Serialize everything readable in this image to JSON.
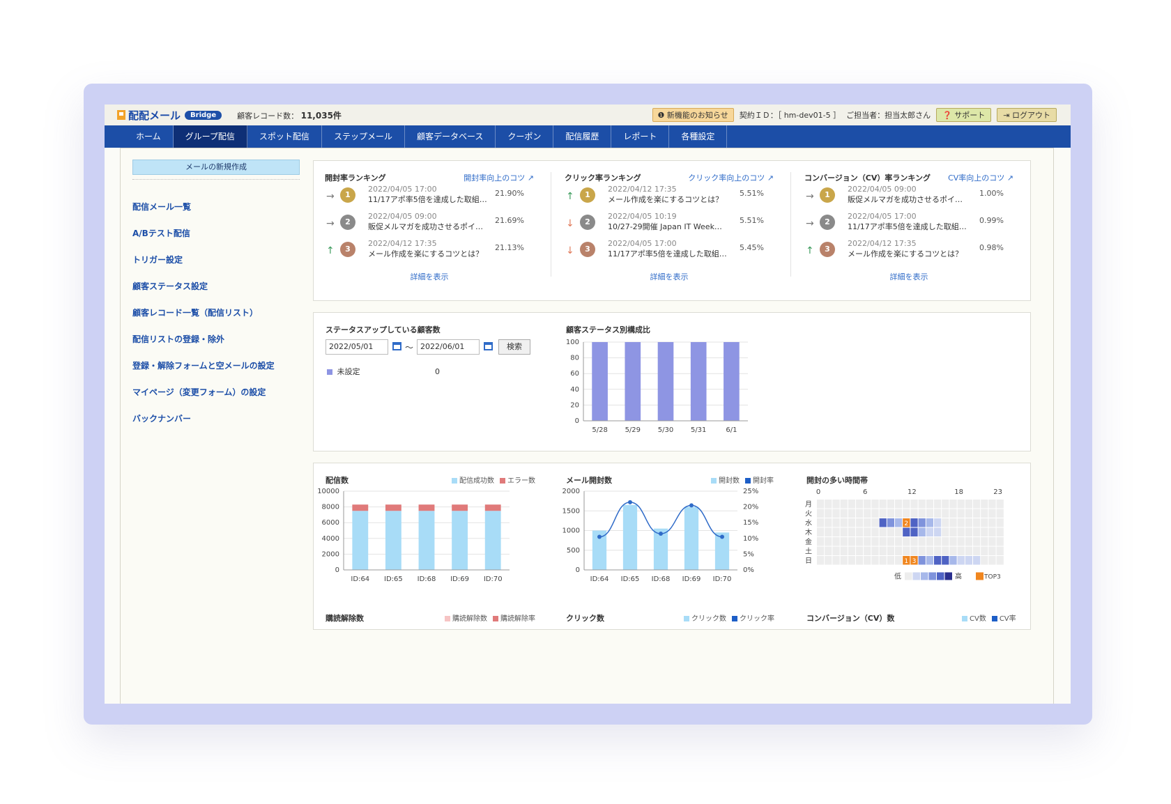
{
  "header": {
    "logo_text": "配配メール",
    "badge": "Bridge",
    "record_label": "顧客レコード数：",
    "record_value": "11,035件",
    "news_label": "新機能のお知らせ",
    "contract": "契約ＩＤ：［ hm-dev01-5 ］",
    "owner": "ご担当者：担当太郎さん",
    "support": "サポート",
    "logout": "ログアウト"
  },
  "nav": [
    "ホーム",
    "グループ配信",
    "スポット配信",
    "ステップメール",
    "顧客データベース",
    "クーポン",
    "配信履歴",
    "レポート",
    "各種設定"
  ],
  "sidebar": {
    "new_button": "メールの新規作成",
    "links": [
      "配信メール一覧",
      "A/Bテスト配信",
      "トリガー設定",
      "顧客ステータス設定",
      "顧客レコード一覧（配信リスト）",
      "配信リストの登録・除外",
      "登録・解除フォームと空メールの設定",
      "マイページ（変更フォーム）の設定",
      "バックナンバー"
    ]
  },
  "rankings": [
    {
      "title": "開封率ランキング",
      "tip": "開封率向上のコツ",
      "detail": "詳細を表示",
      "rows": [
        {
          "arrow": "→",
          "rank": "1",
          "date": "2022/04/05 17:00",
          "text": "11/17アポ率5倍を達成した取組…",
          "pct": "21.90%"
        },
        {
          "arrow": "→",
          "rank": "2",
          "date": "2022/04/05 09:00",
          "text": "販促メルマガを成功させるポイン…",
          "pct": "21.69%"
        },
        {
          "arrow": "↑",
          "rank": "3",
          "date": "2022/04/12 17:35",
          "text": "メール作成を楽にするコツとは？",
          "pct": "21.13%"
        }
      ]
    },
    {
      "title": "クリック率ランキング",
      "tip": "クリック率向上のコツ",
      "detail": "詳細を表示",
      "rows": [
        {
          "arrow": "↑",
          "rank": "1",
          "date": "2022/04/12 17:35",
          "text": "メール作成を楽にするコツとは？",
          "pct": "5.51%"
        },
        {
          "arrow": "↓",
          "rank": "2",
          "date": "2022/04/05 10:19",
          "text": "10/27-29開催 Japan IT Week…",
          "pct": "5.51%"
        },
        {
          "arrow": "↓",
          "rank": "3",
          "date": "2022/04/05 17:00",
          "text": "11/17アポ率5倍を達成した取組…",
          "pct": "5.45%"
        }
      ]
    },
    {
      "title": "コンバージョン（CV）率ランキング",
      "tip": "CV率向上のコツ",
      "detail": "詳細を表示",
      "rows": [
        {
          "arrow": "→",
          "rank": "1",
          "date": "2022/04/05 09:00",
          "text": "販促メルマガを成功させるポイン…",
          "pct": "1.00%"
        },
        {
          "arrow": "→",
          "rank": "2",
          "date": "2022/04/05 17:00",
          "text": "11/17アポ率5倍を達成した取組…",
          "pct": "0.99%"
        },
        {
          "arrow": "↑",
          "rank": "3",
          "date": "2022/04/12 17:35",
          "text": "メール作成を楽にするコツとは？",
          "pct": "0.98%"
        }
      ]
    }
  ],
  "status": {
    "title": "ステータスアップしている顧客数",
    "date_from": "2022/05/01",
    "tilde": "～",
    "date_to": "2022/06/01",
    "search": "検索",
    "legend_label": "未設定",
    "legend_value": "0",
    "composition_title": "顧客ステータス別構成比"
  },
  "bottom_titles": {
    "delivery": "配信数",
    "open": "メール開封数",
    "heatmap": "開封の多い時間帯",
    "unsub": "購読解除数",
    "click": "クリック数",
    "cv": "コンバージョン（CV）数"
  },
  "bottom_legends": {
    "delivery": [
      "配信成功数",
      "エラー数"
    ],
    "open": [
      "開封数",
      "開封率"
    ],
    "unsub": [
      "購読解除数",
      "購読解除率"
    ],
    "click": [
      "クリック数",
      "クリック率"
    ],
    "cv": [
      "CV数",
      "CV率"
    ]
  },
  "colors": {
    "gold": "#c9a64a",
    "silver": "#8a8a8a",
    "bronze": "#b9826a",
    "bar_status": "#8e95e3",
    "bar_light": "#a8dcf7",
    "bar_error": "#e07a7a",
    "line": "#2f6bc8",
    "up": "#3a9a5a",
    "down": "#e07a5a",
    "flat": "#777777",
    "top3": "#f0861f"
  },
  "chart_data": [
    {
      "type": "bar",
      "title": "顧客ステータス別構成比",
      "categories": [
        "5/28",
        "5/29",
        "5/30",
        "5/31",
        "6/1"
      ],
      "series": [
        {
          "values": [
            100,
            100,
            100,
            100,
            100
          ]
        }
      ],
      "ylim": [
        0,
        100
      ],
      "yticks": [
        0,
        20,
        40,
        60,
        80,
        100
      ]
    },
    {
      "type": "bar",
      "title": "配信数",
      "categories": [
        "ID:64",
        "ID:65",
        "ID:68",
        "ID:69",
        "ID:70"
      ],
      "series": [
        {
          "name": "配信成功数",
          "values": [
            7500,
            7500,
            7500,
            7500,
            7500
          ]
        },
        {
          "name": "エラー数",
          "values": [
            800,
            800,
            800,
            800,
            800
          ]
        }
      ],
      "stacked": true,
      "ylim": [
        0,
        10000
      ],
      "yticks": [
        0,
        2000,
        4000,
        6000,
        8000,
        10000
      ]
    },
    {
      "type": "bar",
      "title": "メール開封数",
      "categories": [
        "ID:64",
        "ID:65",
        "ID:68",
        "ID:69",
        "ID:70"
      ],
      "series": [
        {
          "name": "開封数",
          "values": [
            1000,
            1650,
            1050,
            1600,
            950
          ]
        },
        {
          "name": "開封率",
          "values": [
            10.5,
            21.5,
            11.5,
            20.5,
            10.5
          ],
          "type": "line"
        }
      ],
      "ylim": [
        0,
        2000
      ],
      "yticks": [
        0,
        500,
        1000,
        1500,
        2000
      ],
      "y2ticks": [
        "0%",
        "5%",
        "10%",
        "15%",
        "20%",
        "25%"
      ]
    },
    {
      "type": "heatmap",
      "title": "開封の多い時間帯",
      "xticks": [
        "0",
        "6",
        "12",
        "18",
        "23"
      ],
      "rows": [
        "月",
        "火",
        "水",
        "木",
        "金",
        "土",
        "日"
      ],
      "cells": [
        {
          "day": 2,
          "hour": 8,
          "level": 4
        },
        {
          "day": 2,
          "hour": 9,
          "level": 3
        },
        {
          "day": 2,
          "hour": 10,
          "level": 2
        },
        {
          "day": 2,
          "hour": 11,
          "level": 5,
          "top": "2"
        },
        {
          "day": 2,
          "hour": 12,
          "level": 4
        },
        {
          "day": 2,
          "hour": 13,
          "level": 3
        },
        {
          "day": 2,
          "hour": 14,
          "level": 2
        },
        {
          "day": 2,
          "hour": 15,
          "level": 1
        },
        {
          "day": 3,
          "hour": 11,
          "level": 4
        },
        {
          "day": 3,
          "hour": 12,
          "level": 4
        },
        {
          "day": 3,
          "hour": 13,
          "level": 2
        },
        {
          "day": 3,
          "hour": 14,
          "level": 1
        },
        {
          "day": 3,
          "hour": 15,
          "level": 1
        },
        {
          "day": 6,
          "hour": 11,
          "level": 5,
          "top": "1"
        },
        {
          "day": 6,
          "hour": 12,
          "level": 5,
          "top": "3"
        },
        {
          "day": 6,
          "hour": 13,
          "level": 3
        },
        {
          "day": 6,
          "hour": 14,
          "level": 2
        },
        {
          "day": 6,
          "hour": 15,
          "level": 4
        },
        {
          "day": 6,
          "hour": 16,
          "level": 4
        },
        {
          "day": 6,
          "hour": 17,
          "level": 2
        },
        {
          "day": 6,
          "hour": 18,
          "level": 1
        },
        {
          "day": 6,
          "hour": 19,
          "level": 1
        },
        {
          "day": 6,
          "hour": 20,
          "level": 1
        }
      ],
      "legend_low": "低",
      "legend_high": "高",
      "legend_top": "TOP3"
    }
  ]
}
